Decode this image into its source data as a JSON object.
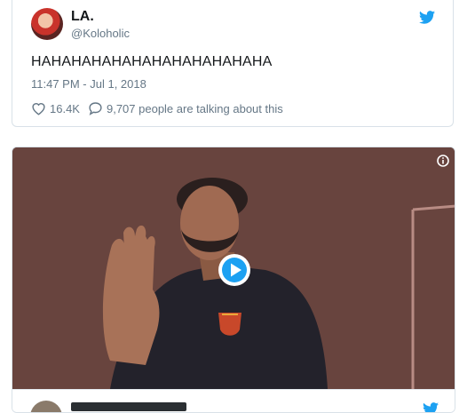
{
  "tweet": {
    "display_name": "LA.",
    "handle": "@Koloholic",
    "text": "HAHAHAHAHAHAHAHAHAHAHAHA",
    "timestamp": "11:47 PM - Jul 1, 2018",
    "likes": "16.4K",
    "talking": "9,707 people are talking about this"
  },
  "icons": {
    "twitter": "twitter-bird-icon",
    "like": "heart-icon",
    "reply": "speech-bubble-icon",
    "info": "info-icon",
    "play": "play-icon"
  },
  "colors": {
    "brand_blue": "#1da1f2",
    "text_primary": "#14171a",
    "text_secondary": "#657786"
  }
}
